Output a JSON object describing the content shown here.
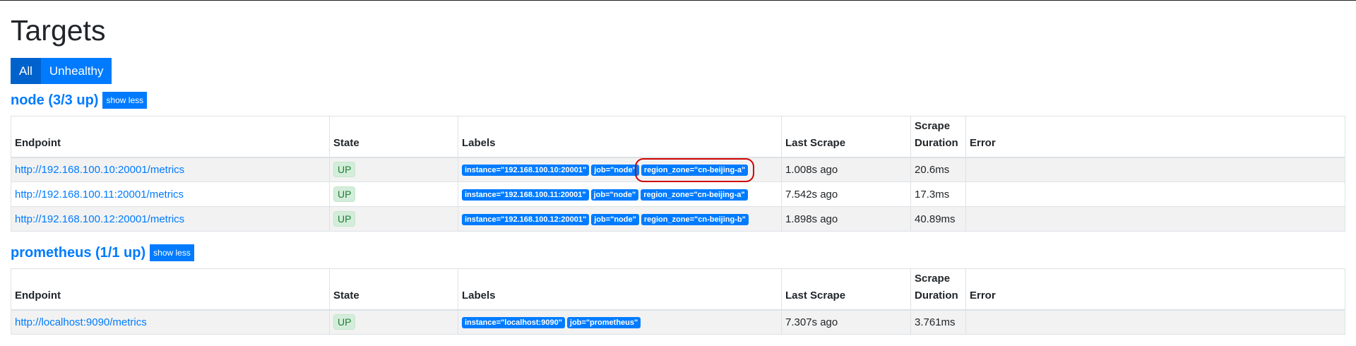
{
  "page": {
    "title": "Targets"
  },
  "filters": {
    "all": "All",
    "unhealthy": "Unhealthy"
  },
  "columns": {
    "endpoint": "Endpoint",
    "state": "State",
    "labels": "Labels",
    "last_scrape": "Last Scrape",
    "scrape_duration": "Scrape Duration",
    "error": "Error"
  },
  "groups": [
    {
      "title": "node (3/3 up)",
      "toggle_label": "show less",
      "targets": [
        {
          "endpoint": "http://192.168.100.10:20001/metrics",
          "state": "UP",
          "labels": [
            "instance=\"192.168.100.10:20001\"",
            "job=\"node\"",
            "region_zone=\"cn-beijing-a\""
          ],
          "last_scrape": "1.008s ago",
          "scrape_duration": "20.6ms",
          "error": ""
        },
        {
          "endpoint": "http://192.168.100.11:20001/metrics",
          "state": "UP",
          "labels": [
            "instance=\"192.168.100.11:20001\"",
            "job=\"node\"",
            "region_zone=\"cn-beijing-a\""
          ],
          "last_scrape": "7.542s ago",
          "scrape_duration": "17.3ms",
          "error": ""
        },
        {
          "endpoint": "http://192.168.100.12:20001/metrics",
          "state": "UP",
          "labels": [
            "instance=\"192.168.100.12:20001\"",
            "job=\"node\"",
            "region_zone=\"cn-beijing-b\""
          ],
          "last_scrape": "1.898s ago",
          "scrape_duration": "40.89ms",
          "error": ""
        }
      ]
    },
    {
      "title": "prometheus (1/1 up)",
      "toggle_label": "show less",
      "targets": [
        {
          "endpoint": "http://localhost:9090/metrics",
          "state": "UP",
          "labels": [
            "instance=\"localhost:9090\"",
            "job=\"prometheus\""
          ],
          "last_scrape": "7.307s ago",
          "scrape_duration": "3.761ms",
          "error": ""
        }
      ]
    }
  ],
  "colors": {
    "primary": "#007bff",
    "primary_active": "#0062cc",
    "up_badge_bg": "#d4edda",
    "up_badge_text": "#1e7e34",
    "highlight_box": "#d00000"
  }
}
